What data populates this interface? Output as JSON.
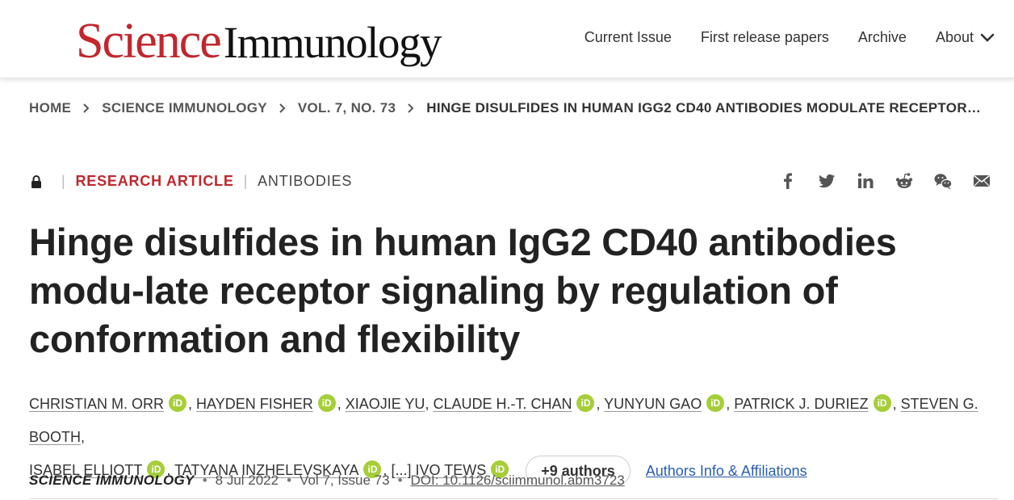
{
  "header": {
    "logo_science": "Science",
    "logo_immunology": "Immunology",
    "nav": [
      {
        "label": "Current Issue"
      },
      {
        "label": "First release papers"
      },
      {
        "label": "Archive"
      },
      {
        "label": "About",
        "icon": "chevron-down-icon"
      }
    ]
  },
  "breadcrumb": [
    "HOME",
    "SCIENCE IMMUNOLOGY",
    "VOL. 7, NO. 73",
    "HINGE DISULFIDES IN HUMAN IGG2 CD40 ANTIBODIES MODULATE RECEPTOR…"
  ],
  "article": {
    "access_icon": "lock-icon",
    "type": "RESEARCH ARTICLE",
    "subject": "ANTIBODIES",
    "title": "Hinge disulfides in human IgG2 CD40 antibodies modu-late receptor signaling by regulation of conformation and flexibility",
    "share": [
      "facebook-icon",
      "twitter-icon",
      "linkedin-icon",
      "reddit-icon",
      "wechat-icon",
      "email-icon"
    ],
    "authors": [
      {
        "name": "CHRISTIAN M. ORR",
        "orcid": true
      },
      {
        "name": "HAYDEN FISHER",
        "orcid": true
      },
      {
        "name": "XIAOJIE YU",
        "orcid": false
      },
      {
        "name": "CLAUDE H.-T. CHAN",
        "orcid": true
      },
      {
        "name": "YUNYUN GAO",
        "orcid": true
      },
      {
        "name": "PATRICK J. DURIEZ",
        "orcid": true
      },
      {
        "name": "STEVEN G. BOOTH",
        "orcid": false
      },
      {
        "name": "ISABEL ELLIOTT",
        "orcid": true
      },
      {
        "name": "TATYANA INZHELEVSKAYA",
        "orcid": true
      },
      {
        "name": "IVO TEWS",
        "orcid": true
      }
    ],
    "orcid_label": "iD",
    "ellipsis": "[...]",
    "more_authors": "+9 authors",
    "affiliations_link": "Authors Info & Affiliations",
    "journal": "SCIENCE IMMUNOLOGY",
    "date": "8 Jul 2022",
    "volume_issue": "Vol 7, Issue 73",
    "doi": "DOI: 10.1126/sciimmunol.abm3723"
  },
  "colors": {
    "brand_red": "#c1272d",
    "orcid_green": "#a6ce39",
    "link_blue": "#2a5db0"
  }
}
